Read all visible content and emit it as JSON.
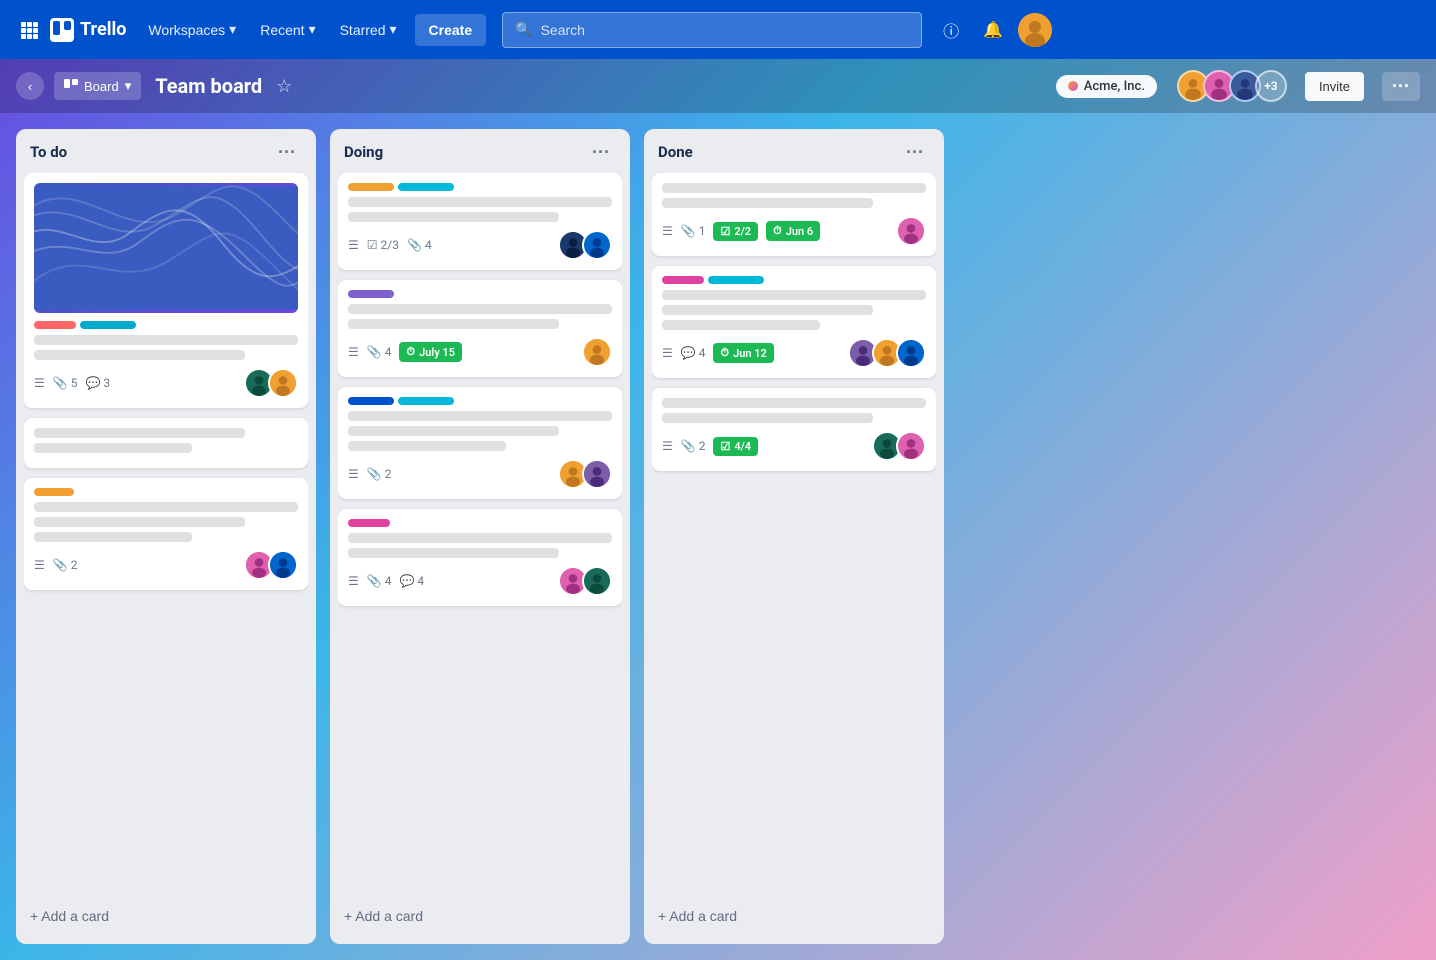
{
  "nav": {
    "logo": "Trello",
    "workspaces": "Workspaces",
    "recent": "Recent",
    "starred": "Starred",
    "create": "Create",
    "search_placeholder": "Search"
  },
  "board": {
    "title": "Team board",
    "workspace": "Acme, Inc.",
    "members_extra": "+3",
    "invite": "Invite",
    "view": "Board"
  },
  "columns": [
    {
      "id": "todo",
      "title": "To do",
      "add_card": "+ Add a card"
    },
    {
      "id": "doing",
      "title": "Doing",
      "add_card": "+ Add a card"
    },
    {
      "id": "done",
      "title": "Done",
      "add_card": "+ Add a card"
    }
  ],
  "cards": {
    "todo": [
      {
        "id": "todo-1",
        "has_cover": true,
        "labels": [
          "pink",
          "cyan"
        ],
        "lines": [
          "long",
          "medium"
        ],
        "meta": {
          "desc": true,
          "attachments": 5,
          "comments": 3
        },
        "avatars": [
          "teal",
          "yellow"
        ]
      },
      {
        "id": "todo-2",
        "labels": [],
        "lines": [
          "medium",
          "short"
        ],
        "meta": {},
        "avatars": []
      },
      {
        "id": "todo-3",
        "labels": [
          "yellow"
        ],
        "lines": [
          "long",
          "medium",
          "short"
        ],
        "meta": {
          "desc": true,
          "attachments": 2
        },
        "avatars": [
          "pink",
          "blue"
        ]
      }
    ],
    "doing": [
      {
        "id": "doing-1",
        "labels": [
          "yellow2",
          "teal"
        ],
        "lines": [
          "long",
          "medium"
        ],
        "meta": {
          "desc": true,
          "checklist": "2/3",
          "attachments": 4
        },
        "avatars": [
          "darkblue",
          "lightblue"
        ]
      },
      {
        "id": "doing-2",
        "labels": [
          "purple"
        ],
        "lines": [
          "long",
          "medium"
        ],
        "meta": {
          "desc": true,
          "attachments": 4,
          "due": "July 15"
        },
        "avatars": [
          "yellow"
        ]
      },
      {
        "id": "doing-3",
        "labels": [
          "blue2",
          "cyan2"
        ],
        "lines": [
          "long",
          "medium",
          "short"
        ],
        "meta": {
          "desc": true,
          "attachments": 2
        },
        "avatars": [
          "yellow",
          "purple"
        ]
      },
      {
        "id": "doing-4",
        "labels": [
          "magenta"
        ],
        "lines": [
          "long",
          "medium"
        ],
        "meta": {
          "desc": true,
          "attachments": 4,
          "comments": 4
        },
        "avatars": [
          "pink",
          "teal"
        ]
      }
    ],
    "done": [
      {
        "id": "done-1",
        "labels": [],
        "lines": [
          "long",
          "medium"
        ],
        "meta": {
          "desc": true,
          "attachments": 1,
          "checklist": "2/2",
          "due": "Jun 6"
        },
        "avatars": [
          "pink2"
        ]
      },
      {
        "id": "done-2",
        "labels": [
          "magenta2",
          "cyan3"
        ],
        "lines": [
          "long",
          "medium",
          "short"
        ],
        "meta": {
          "desc": true,
          "comments": 4,
          "due": "Jun 12"
        },
        "avatars": [
          "purple2",
          "yellow2",
          "blue2"
        ]
      },
      {
        "id": "done-3",
        "labels": [],
        "lines": [
          "long",
          "medium"
        ],
        "meta": {
          "desc": true,
          "attachments": 2,
          "checklist": "4/4"
        },
        "avatars": [
          "teal2",
          "pink3"
        ]
      }
    ]
  }
}
